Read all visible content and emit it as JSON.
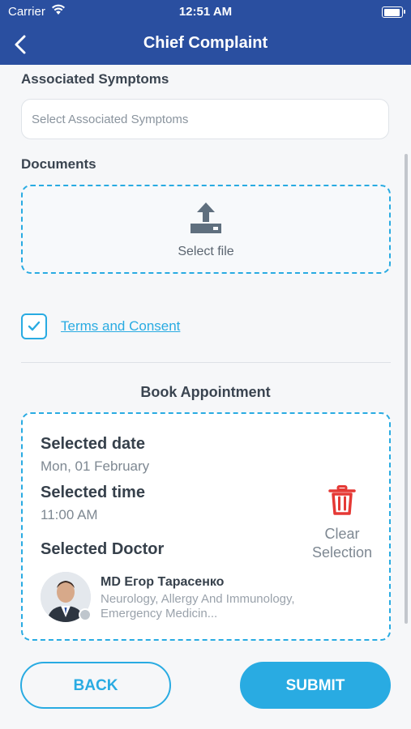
{
  "status_bar": {
    "carrier": "Carrier",
    "time": "12:51 AM"
  },
  "nav": {
    "title": "Chief Complaint",
    "back_icon": "chevron-left-icon"
  },
  "symptoms": {
    "label": "Associated Symptoms",
    "placeholder": "Select Associated Symptoms"
  },
  "documents": {
    "label": "Documents",
    "upload_label": "Select file",
    "upload_icon": "upload-icon"
  },
  "consent": {
    "checked": true,
    "label": "Terms and Consent"
  },
  "appointment": {
    "heading": "Book Appointment",
    "date_label": "Selected date",
    "date_value": "Mon, 01 February",
    "time_label": "Selected time",
    "time_value": "11:00 AM",
    "doctor_label": "Selected Doctor",
    "clear_label": "Clear Selection",
    "doctor": {
      "name": "MD Егор Тарасенко",
      "specialty": "Neurology, Allergy And Immunology, Emergency Medicin..."
    }
  },
  "buttons": {
    "back": "BACK",
    "submit": "SUBMIT"
  },
  "colors": {
    "header": "#2a4fa0",
    "accent": "#29abe2",
    "delete": "#e53935"
  }
}
